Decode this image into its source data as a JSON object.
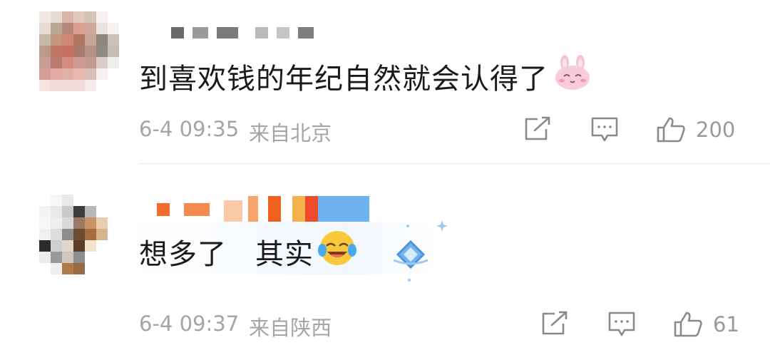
{
  "comments": [
    {
      "text": "到喜欢钱的年纪自然就会认得了",
      "emoji_icon": "bunny-face-emoji",
      "date": "6-4 09:35",
      "location": "来自北京",
      "likes": "200"
    },
    {
      "text_part1": "想多了",
      "text_part2": "其实",
      "emoji_icon": "laughing-crying-emoji",
      "badge_icon": "blue-diamond-badge",
      "date": "6-4 09:37",
      "location": "来自陕西",
      "likes": "61"
    }
  ],
  "colors": {
    "text": "#1a1a1a",
    "meta": "#a5a5a5",
    "icon": "#8a8a8a",
    "divider": "#e9e9e9"
  }
}
